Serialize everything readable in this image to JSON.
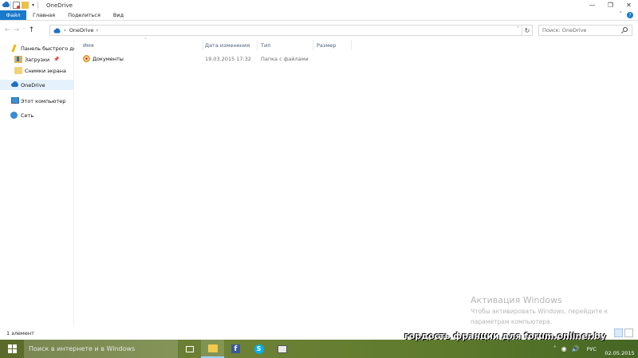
{
  "window": {
    "title": "OneDrive",
    "controls": {
      "minimize": "—",
      "maximize": "❐",
      "close": "✕"
    }
  },
  "ribbon": {
    "tabs": [
      "Файл",
      "Главная",
      "Поделиться",
      "Вид"
    ],
    "collapse": "˅",
    "help": "?"
  },
  "address": {
    "back": "←",
    "forward": "→",
    "recent": "˅",
    "up": "↑",
    "crumb_sep": "›",
    "crumbs": [
      "OneDrive"
    ],
    "trailing_sep": "›",
    "dropdown": "˅",
    "refresh": "↻"
  },
  "search": {
    "placeholder": "Поиск: OneDrive"
  },
  "nav": {
    "quick_access": "Панель быстрого доступа",
    "downloads": "Загрузки",
    "pin": "📌",
    "screenshots": "Снимки экрана",
    "onedrive": "OneDrive",
    "this_pc": "Этот компьютер",
    "network": "Сеть"
  },
  "columns": {
    "name": "Имя",
    "date": "Дата изменения",
    "type": "Тип",
    "size": "Размер",
    "sort_indicator": "˄"
  },
  "files": [
    {
      "name": "Документы",
      "date": "19.03.2015 17:32",
      "type": "Папка с файлами",
      "size": ""
    }
  ],
  "watermark": {
    "title": "Активация Windows",
    "line1": "Чтобы активировать Windows, перейдите к",
    "line2": "параметрам компьютера."
  },
  "status": {
    "count": "1 элемент"
  },
  "taskbar": {
    "search_placeholder": "Поиск в интернете и в Windows",
    "facebook_letter": "f",
    "skype_letter": "S",
    "banner": "гордость франции для forum.onliner.by",
    "language": "РУС",
    "date": "02.05.2015",
    "tray_icons": {
      "chevron": "˄",
      "wifi": "◉",
      "volume": "🔊"
    }
  },
  "colors": {
    "accent": "#1979ca",
    "selection": "#e5f1fb",
    "taskbar": "#6e8236"
  }
}
